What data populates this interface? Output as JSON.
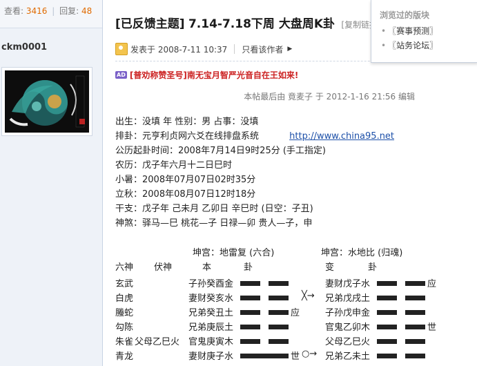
{
  "sidebar": {
    "views_label": "查看:",
    "views": "3416",
    "replies_label": "回复:",
    "replies": "48",
    "username": "ckm0001"
  },
  "post": {
    "title_bracket": "[已反馈主题]",
    "title_text": "7.14-7.18下周 大盘周K卦",
    "copy_link": "[复制链接]",
    "posted": "发表于 2008-7-11 10:37",
    "only_author": "只看该作者",
    "ad_badge": "AD",
    "ad_text": "[普劝称赞圣号]南无宝月智严光音自在王如来!",
    "edited": "本帖最后由 竟麦子 于 2012-1-16 21:56 编辑",
    "lines": [
      "出生：没填 年   性别：男   占事：没填",
      "排卦：元亨利贞网六爻在线排盘系统",
      "公历起卦时间：2008年7月14日9时25分    (手工指定)",
      "农历：戊子年六月十二日巳时",
      "小暑：2008年07月07日02时35分",
      "立秋：2008年08月07日12时18分",
      "干支：戊子年    己未月    乙卯日    辛巳时        (日空：子丑)",
      "神煞：驿马—巳    桃花—子    日禄—卯    贵人—子，申"
    ],
    "link_url": "http://www.china95.net"
  },
  "gua": {
    "ben_title": "坤宫：地雷复 (六合)",
    "bian_title": "坤宫：水地比 (归魂)",
    "headers": [
      "六神",
      "伏神",
      "本",
      "卦",
      "变",
      "卦"
    ],
    "rows": [
      {
        "shen": "玄武",
        "fu": "",
        "ben": "子孙癸酉金",
        "mark": "",
        "op": "",
        "bian": "妻财戊子水",
        "bmark": "应"
      },
      {
        "shen": "白虎",
        "fu": "",
        "ben": "妻财癸亥水",
        "mark": "",
        "op": "╳→",
        "bian": "兄弟戊戌土",
        "bmark": ""
      },
      {
        "shen": "螣蛇",
        "fu": "",
        "ben": "兄弟癸丑土",
        "mark": "应",
        "op": "",
        "bian": "子孙戊申金",
        "bmark": ""
      },
      {
        "shen": "勾陈",
        "fu": "",
        "ben": "兄弟庚辰土",
        "mark": "",
        "op": "",
        "bian": "官鬼乙卯木",
        "bmark": "世"
      },
      {
        "shen": "朱雀",
        "fu": "父母乙巳火",
        "ben": "官鬼庚寅木",
        "mark": "",
        "op": "",
        "bian": "父母乙巳火",
        "bmark": ""
      },
      {
        "shen": "青龙",
        "fu": "",
        "ben": "妻财庚子水",
        "mark": "世",
        "op": "○→",
        "bian": "兄弟乙未土",
        "bmark": ""
      }
    ],
    "ben_yang": [
      false,
      false,
      false,
      false,
      false,
      true
    ],
    "bian_yang": [
      false,
      false,
      false,
      false,
      false,
      false
    ]
  },
  "popup": {
    "title": "浏览过的版块",
    "items": [
      "〖赛事预测〗",
      "〖站务论坛〗"
    ]
  }
}
